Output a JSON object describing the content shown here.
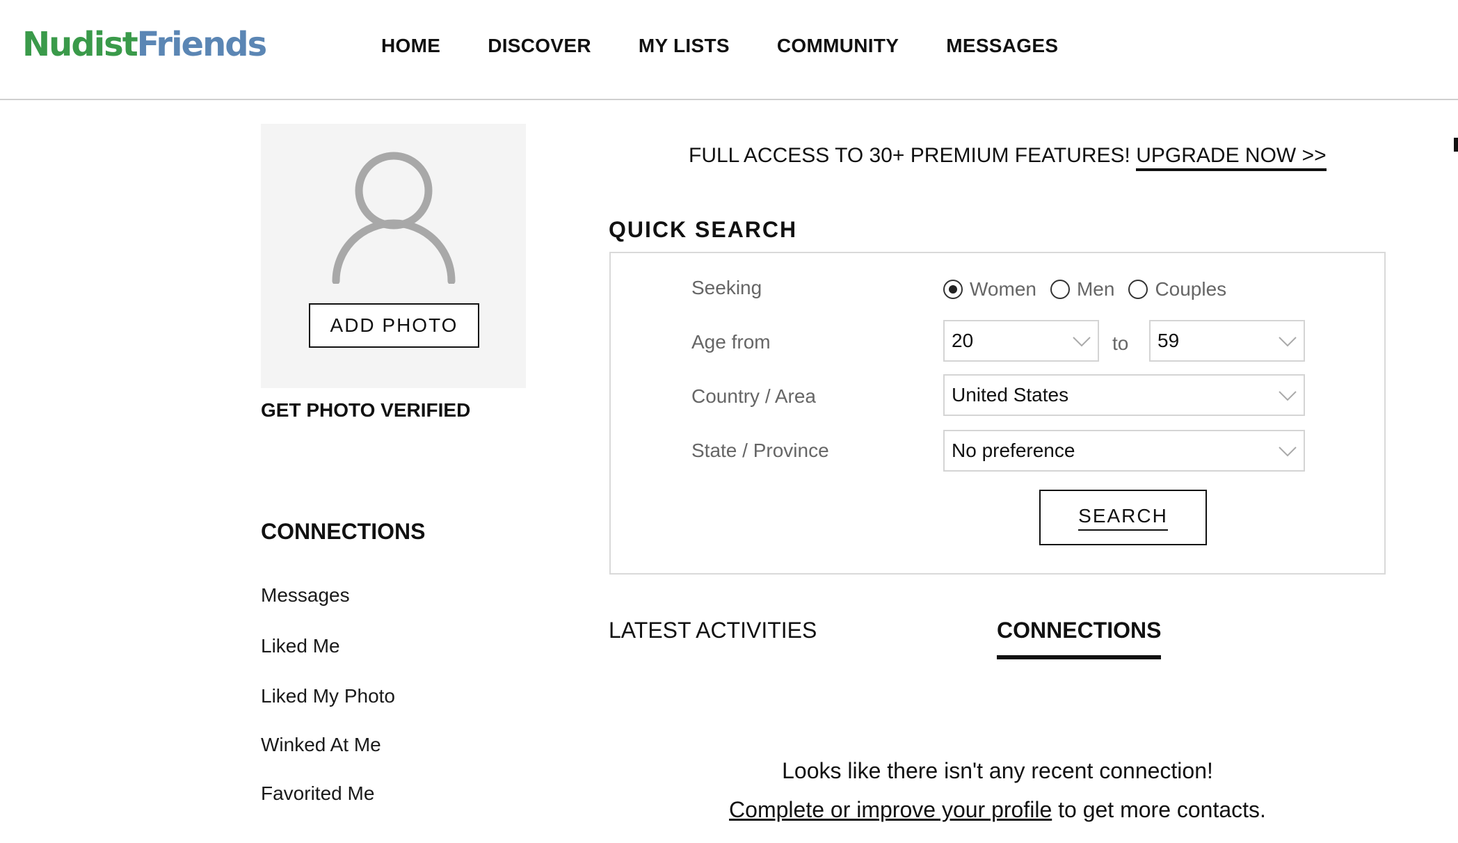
{
  "header": {
    "logo_part1": "Nudist",
    "logo_part2": "Friends",
    "nav": [
      "HOME",
      "DISCOVER",
      "MY LISTS",
      "COMMUNITY",
      "MESSAGES"
    ]
  },
  "sidebar": {
    "add_photo_label": "ADD PHOTO",
    "verify_label": "GET PHOTO VERIFIED",
    "connections_title": "CONNECTIONS",
    "connections_items": [
      "Messages",
      "Liked Me",
      "Liked My Photo",
      "Winked At Me",
      "Favorited Me"
    ]
  },
  "promo": {
    "text": "FULL ACCESS TO 30+ PREMIUM FEATURES! ",
    "link": "UPGRADE NOW >>"
  },
  "quick_search": {
    "title": "QUICK SEARCH",
    "seeking_label": "Seeking",
    "seeking_options": [
      "Women",
      "Men",
      "Couples"
    ],
    "seeking_selected": "Women",
    "age_label": "Age from",
    "age_from": "20",
    "age_to_label": "to",
    "age_to": "59",
    "country_label": "Country / Area",
    "country_value": "United States",
    "state_label": "State / Province",
    "state_value": "No preference",
    "search_button": "SEARCH"
  },
  "tabs": {
    "latest": "LATEST ACTIVITIES",
    "connections": "CONNECTIONS",
    "active": "CONNECTIONS"
  },
  "empty_state": {
    "line1": "Looks like there isn't any recent connection!",
    "link": "Complete or improve your profile",
    "line2_rest": " to get more contacts."
  },
  "colors": {
    "logo_green": "#3a9a4a",
    "logo_blue": "#5b86b4",
    "photo_bg": "#f4f4f4",
    "border_gray": "#d9d9d9"
  },
  "icons": [
    "avatar-placeholder-icon",
    "chevron-down-icon",
    "radio-icon"
  ]
}
